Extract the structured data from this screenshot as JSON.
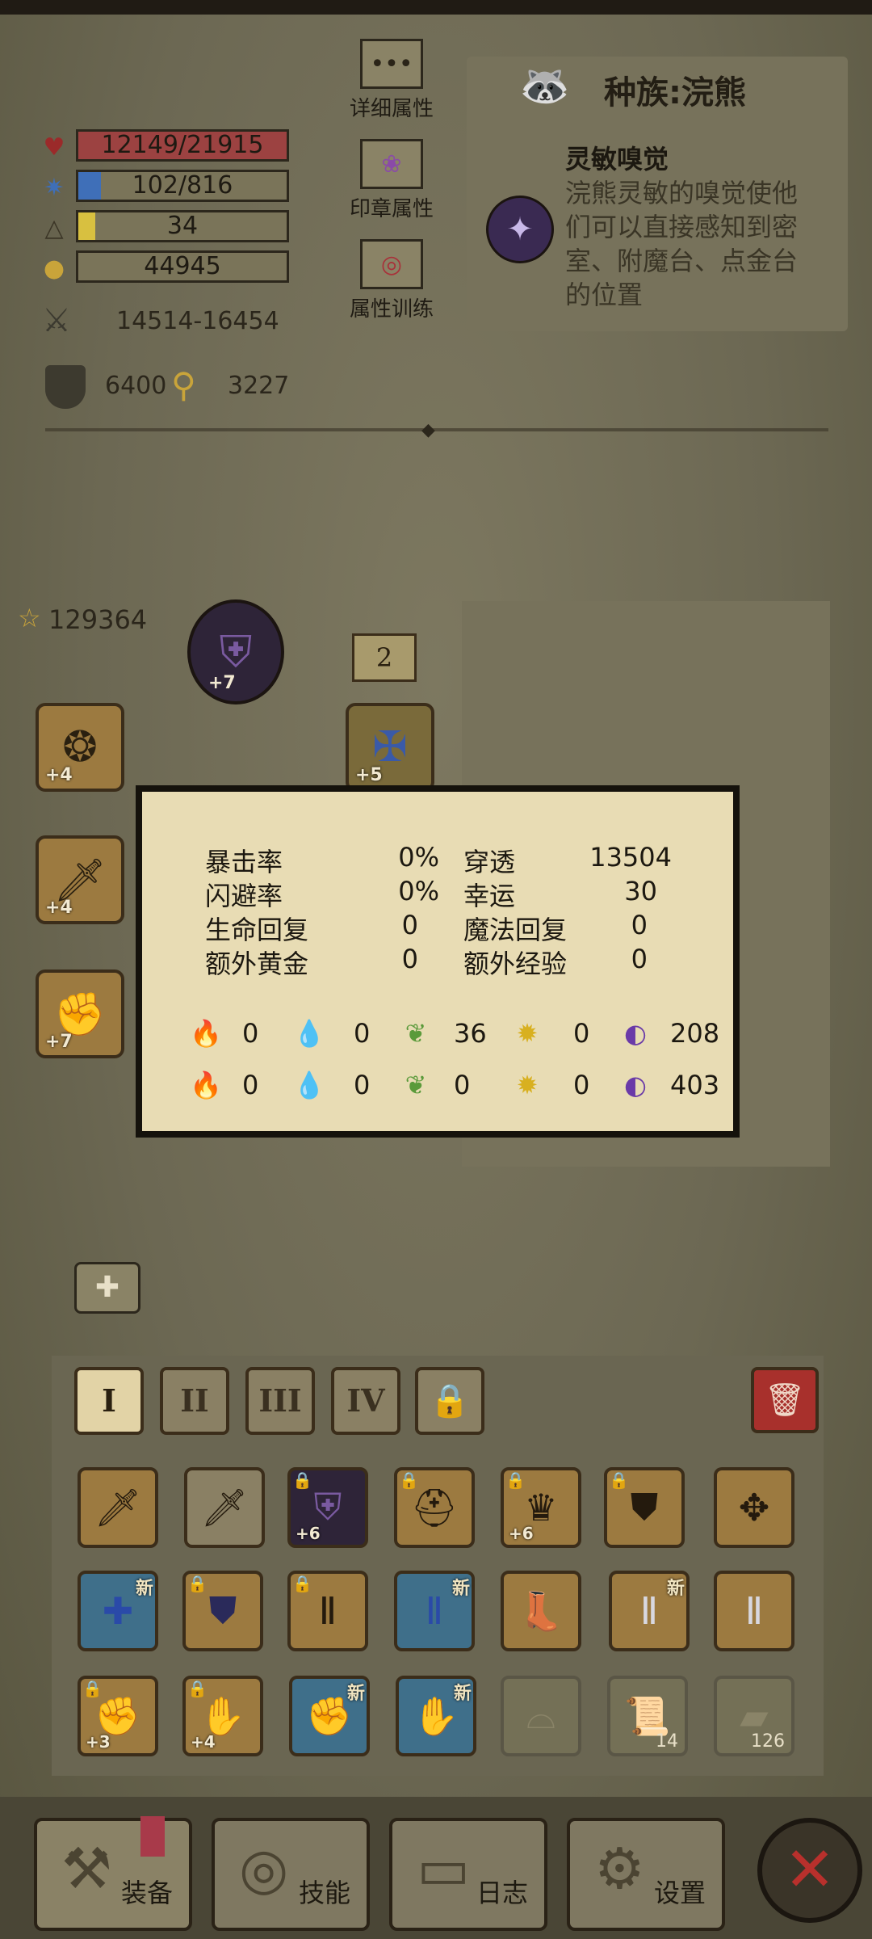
{
  "stats": {
    "hp": "12149/21915",
    "mp": "102/816",
    "level": "34",
    "gold": "44945",
    "attack": "14514-16454",
    "armor": "6400",
    "magic_resist": "3227"
  },
  "side_buttons": {
    "detail_attr": "详细属性",
    "seal_attr": "印章属性",
    "attr_training": "属性训练"
  },
  "race": {
    "title": "种族:浣熊",
    "skill_name": "灵敏嗅觉",
    "skill_desc_1": "浣熊灵敏的嗅觉使他",
    "skill_desc_2": "们可以直接感知到密",
    "skill_desc_3": "室、附魔台、点金台",
    "skill_desc_4": "的位置"
  },
  "equipment": {
    "score": "129364",
    "page_badge": "2",
    "helmet_plus": "+7",
    "left1_plus": "+4",
    "right1_plus": "+5",
    "left2_plus": "+4",
    "left3_plus": "+7"
  },
  "popup": {
    "crit_label": "暴击率",
    "crit_value": "0%",
    "pen_label": "穿透",
    "pen_value": "13504",
    "dodge_label": "闪避率",
    "dodge_value": "0%",
    "luck_label": "幸运",
    "luck_value": "30",
    "hp_regen_label": "生命回复",
    "hp_regen_value": "0",
    "mp_regen_label": "魔法回复",
    "mp_regen_value": "0",
    "gold_label": "额外黄金",
    "gold_value": "0",
    "exp_label": "额外经验",
    "exp_value": "0",
    "elem_attack": [
      "0",
      "0",
      "36",
      "0",
      "208"
    ],
    "elem_resist": [
      "0",
      "0",
      "0",
      "0",
      "403"
    ]
  },
  "inventory": {
    "tabs": [
      "I",
      "II",
      "III",
      "IV"
    ],
    "new_tag": "新",
    "row1_plus": [
      "",
      "",
      "+6",
      "",
      "+6",
      "",
      ""
    ],
    "row3_plus": [
      "+3",
      "+4"
    ],
    "count_scroll": "14",
    "count_stone": "126"
  },
  "nav": {
    "equipment": "装备",
    "skills": "技能",
    "log": "日志",
    "settings": "设置"
  },
  "colors": {
    "hp_fill": "#a8323a",
    "mp_fill": "#3f6fb8",
    "level_fill": "#d8c040",
    "slot_gold": "#9c7a40",
    "slot_blue": "#3f6f8a",
    "close_red": "#b8302c"
  }
}
